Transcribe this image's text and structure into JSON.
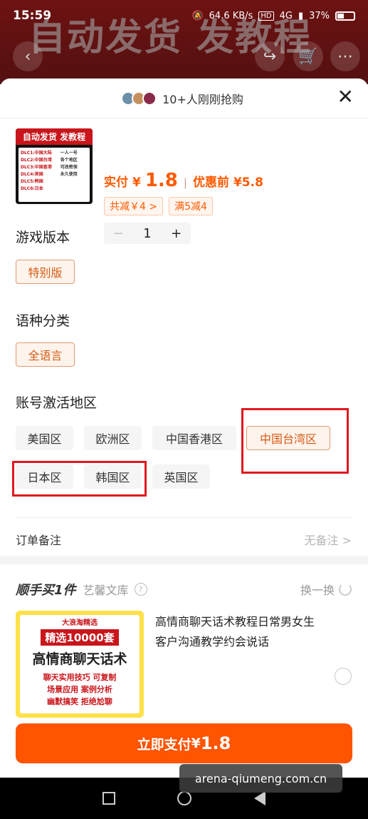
{
  "status_bar": {
    "time": "15:59",
    "speed": "64.6 KB/s",
    "network": "4G",
    "battery": "37%"
  },
  "background": {
    "banner_text": "自动发货 发教程"
  },
  "header": {
    "buyers_text": "10+人刚刚抢购",
    "close_label": "✕"
  },
  "product": {
    "thumb_title": "自动发货 发教程",
    "thumb_left_lines": [
      "DLC1:中国大陆",
      "DLC2:中国台湾",
      "DLC3:中国香港",
      "DLC4:美国",
      "DLC5:韩国",
      "DLC6:日本"
    ],
    "thumb_right_lines": [
      "一人一号",
      "各个地区",
      "可改密保",
      "永久使用"
    ],
    "price_label": "实付",
    "currency": "¥",
    "price": "1.8",
    "original_label": "优惠前",
    "original_price": "¥5.8",
    "saving_tag": "共减￥4 >",
    "promo_tag": "满5减4",
    "quantity": "1",
    "minus": "−",
    "plus": "+"
  },
  "sections": {
    "version": {
      "title": "游戏版本",
      "options": [
        "特别版"
      ],
      "selected": 0
    },
    "language": {
      "title": "语种分类",
      "options": [
        "全语言"
      ],
      "selected": 0
    },
    "region": {
      "title": "账号激活地区",
      "options": [
        "美国区",
        "欧洲区",
        "中国香港区",
        "中国台湾区",
        "日本区",
        "韩国区",
        "英国区"
      ],
      "selected": 3
    }
  },
  "remark": {
    "label": "订单备注",
    "value": "无备注 >"
  },
  "addon": {
    "title": "顺手买1件",
    "shop": "艺馨文库",
    "help_icon": "?",
    "swap_label": "换一换",
    "img_line1": "大浪淘精选",
    "img_line2": "精选10000套",
    "img_line3": "高情商聊天话术",
    "img_line4": "聊天实用技巧 可复制",
    "img_line5": "场景应用 案例分析",
    "img_line6": "幽默搞笑 拒绝尬聊",
    "description": "高情商聊天话术教程日常男女生客户沟通教学约会说话"
  },
  "pay_button": {
    "label": "立即支付",
    "currency": "¥",
    "amount": "1.8"
  },
  "watermark": "arena-qiumeng.com.cn",
  "colors": {
    "accent": "#ff5400",
    "price": "#ff5a00",
    "highlight_box": "#e01820"
  }
}
